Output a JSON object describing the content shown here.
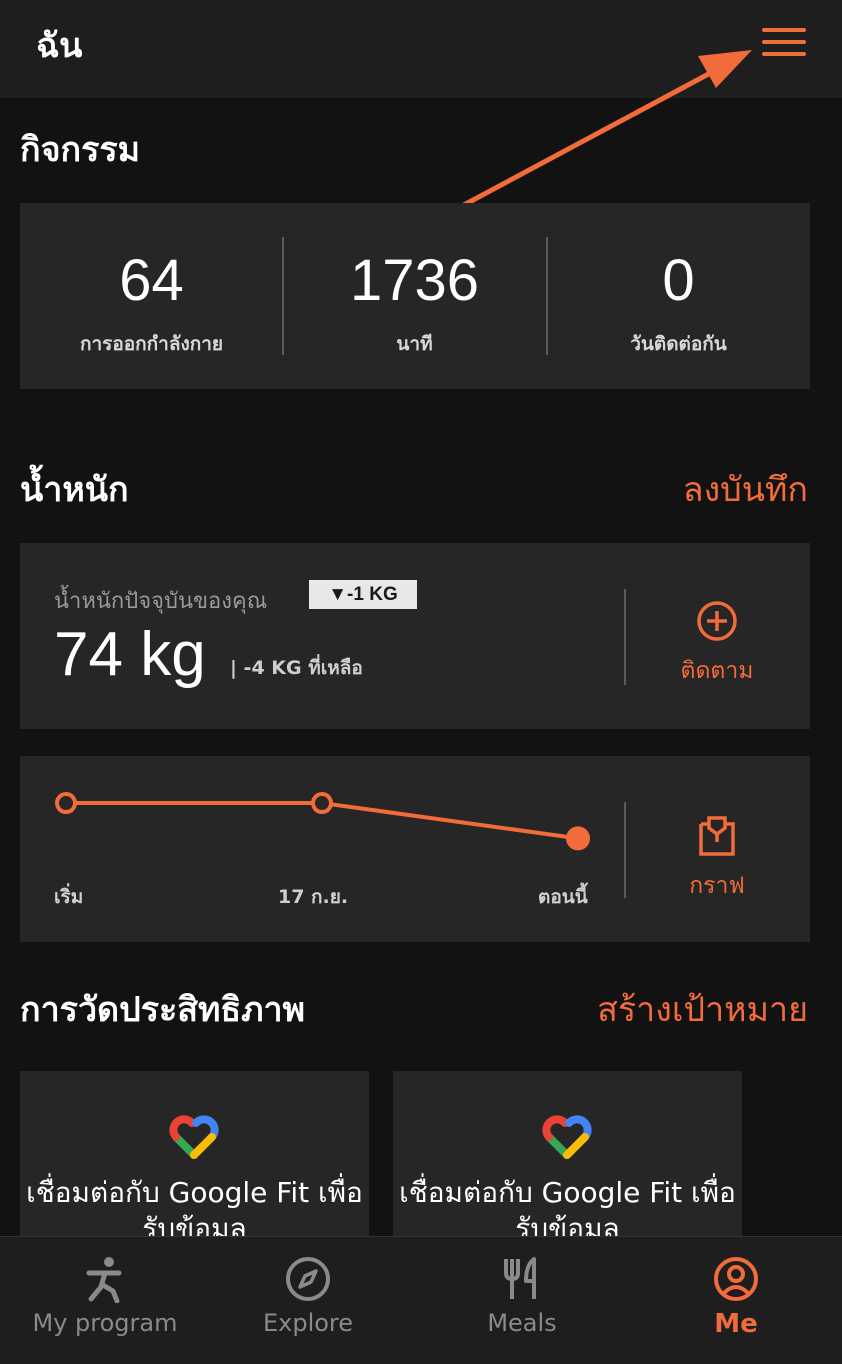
{
  "header": {
    "title": "ฉัน",
    "menu_icon": "hamburger-menu-icon"
  },
  "activity": {
    "title": "กิจกรรม",
    "stats": [
      {
        "value": "64",
        "label": "การออกกำลังกาย"
      },
      {
        "value": "1736",
        "label": "นาที"
      },
      {
        "value": "0",
        "label": "วันติดต่อกัน"
      }
    ]
  },
  "weight": {
    "title": "น้ำหนัก",
    "log_label": "ลงบันทึก",
    "current_label": "น้ำหนักปัจจุบันของคุณ",
    "badge": "▼-1 KG",
    "value": "74 kg",
    "remaining": "| -4 KG ที่เหลือ",
    "track_label": "ติดตาม",
    "graph_label": "กราฟ"
  },
  "chart_data": {
    "type": "line",
    "categories": [
      "เริ่ม",
      "17 ก.ย.",
      "ตอนนี้"
    ],
    "values": [
      75,
      75,
      74
    ],
    "ylim": [
      73.5,
      75.2
    ],
    "grid": false
  },
  "performance": {
    "title": "การวัดประสิทธิภาพ",
    "create_goal_label": "สร้างเป้าหมาย",
    "cards": [
      {
        "text": "เชื่อมต่อกับ Google Fit เพื่อรับข้อมูล"
      },
      {
        "text": "เชื่อมต่อกับ Google Fit เพื่อรับข้อมูล"
      }
    ]
  },
  "bottom_nav": {
    "items": [
      {
        "label": "My program",
        "icon": "running-person-icon"
      },
      {
        "label": "Explore",
        "icon": "compass-icon"
      },
      {
        "label": "Meals",
        "icon": "fork-knife-icon"
      },
      {
        "label": "Me",
        "icon": "profile-icon"
      }
    ],
    "active": "Me"
  },
  "colors": {
    "accent": "#f26b3a",
    "card": "#262626",
    "background": "#121212"
  }
}
